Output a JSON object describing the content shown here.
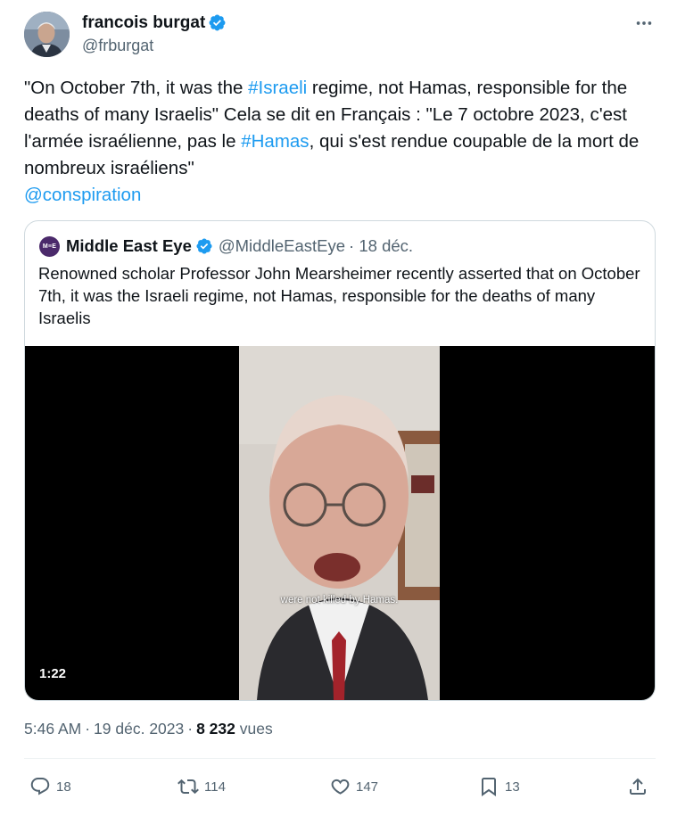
{
  "author": {
    "name": "francois burgat",
    "handle": "@frburgat",
    "verified": true
  },
  "body": {
    "segments": [
      {
        "text": "\"On October 7th, it was the ",
        "link": false
      },
      {
        "text": "#Israeli",
        "link": true
      },
      {
        "text": " regime, not Hamas, responsible for the deaths of many Israelis\" Cela se dit en Français :  \"Le 7 octobre 2023, c'est l'armée israélienne, pas le ",
        "link": false
      },
      {
        "text": "#Hamas",
        "link": true
      },
      {
        "text": ", qui s'est rendue coupable de la mort de nombreux israéliens\"",
        "link": false
      }
    ],
    "mention": "@conspiration"
  },
  "quote": {
    "logo_text": "M≡E",
    "name": "Middle East Eye",
    "handle": "@MiddleEastEye",
    "date": "· 18 déc.",
    "text": "Renowned scholar Professor John Mearsheimer recently asserted that on October 7th, it was the Israeli regime, not Hamas, responsible for the deaths of many Israelis",
    "video": {
      "caption": "were not killed by Hamas.",
      "duration": "1:22"
    }
  },
  "meta": {
    "time": "5:46 AM",
    "date": "19 déc. 2023",
    "views": "8 232",
    "views_label": "vues"
  },
  "actions": {
    "replies": "18",
    "reposts": "114",
    "likes": "147",
    "bookmarks": "13"
  },
  "colors": {
    "link": "#1d9bf0",
    "verified": "#1d9bf0",
    "secondary_text": "#536471",
    "border": "#cfd9de"
  },
  "icons": [
    "more-icon",
    "verified-badge-icon",
    "reply-icon",
    "repost-icon",
    "like-icon",
    "bookmark-icon",
    "share-icon"
  ]
}
